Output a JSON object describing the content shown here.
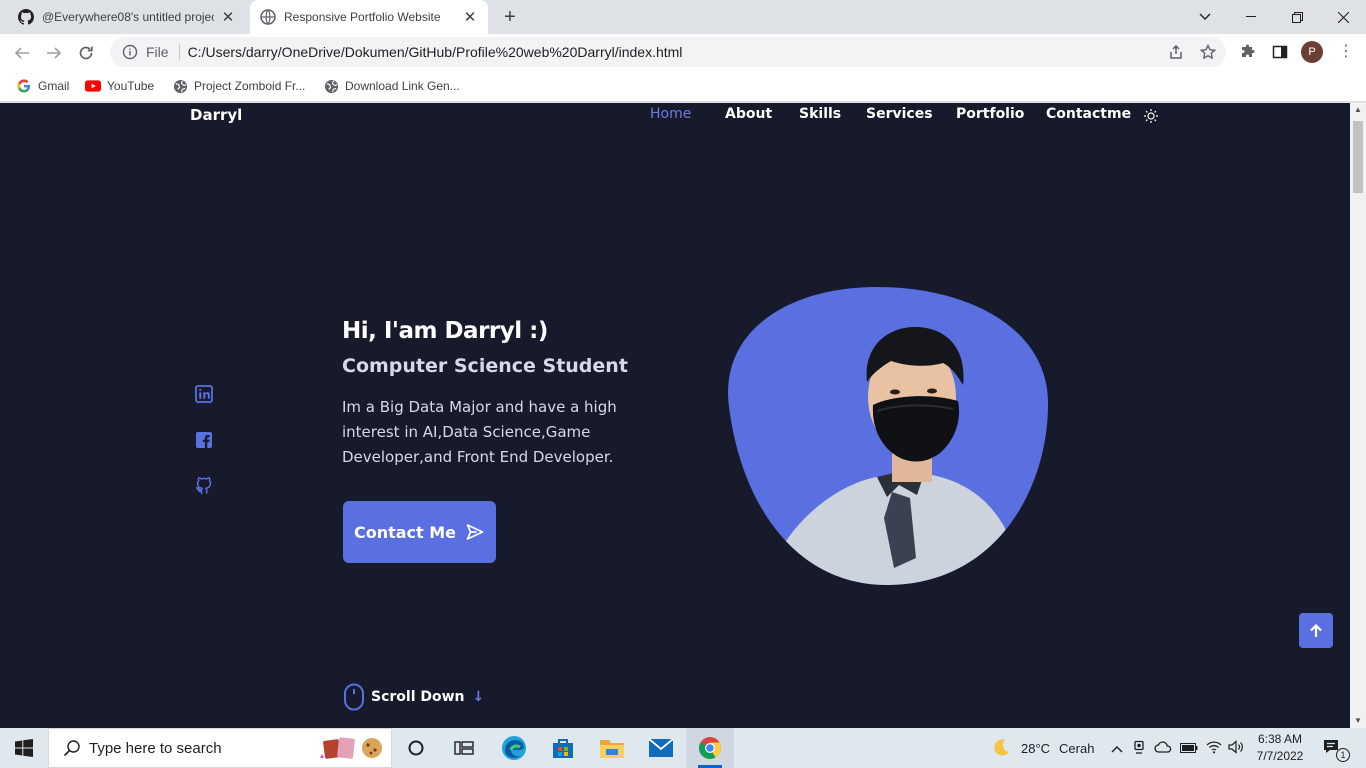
{
  "browser": {
    "tabs": [
      {
        "title": "@Everywhere08's untitled project",
        "icon": "github-icon"
      },
      {
        "title": "Responsive Portfolio Website",
        "icon": "globe-icon"
      }
    ],
    "address": {
      "scheme_label": "File",
      "url": "C:/Users/darry/OneDrive/Dokumen/GitHub/Profile%20web%20Darryl/index.html"
    },
    "profile_initial": "P",
    "bookmarks": [
      {
        "label": "Gmail",
        "icon": "google-icon"
      },
      {
        "label": "YouTube",
        "icon": "youtube-icon"
      },
      {
        "label": "Project Zomboid Fr...",
        "icon": "globe-icon"
      },
      {
        "label": "Download Link Gen...",
        "icon": "globe-icon"
      }
    ]
  },
  "site": {
    "logo": "Darryl",
    "nav": [
      {
        "label": "Home",
        "active": true
      },
      {
        "label": "About",
        "active": false
      },
      {
        "label": "Skills",
        "active": false
      },
      {
        "label": "Services",
        "active": false
      },
      {
        "label": "Portfolio",
        "active": false
      },
      {
        "label": "Contactme",
        "active": false
      }
    ],
    "hero": {
      "title": "Hi, I'am Darryl :)",
      "subtitle": "Computer Science Student",
      "description": "Im a Big Data Major and have a high interest in AI,Data Science,Game Developer,and Front End Developer.",
      "cta_label": "Contact Me"
    },
    "socials": [
      "linkedin-icon",
      "facebook-icon",
      "github-icon"
    ],
    "scroll_label": "Scroll Down",
    "colors": {
      "background": "#171a2a",
      "accent": "#5a6fe0",
      "accent_light": "#6e79e8"
    }
  },
  "taskbar": {
    "search_placeholder": "Type here to search",
    "weather": {
      "temp": "28°C",
      "condition": "Cerah"
    },
    "time": "6:38 AM",
    "date": "7/7/2022",
    "notification_count": "1"
  }
}
